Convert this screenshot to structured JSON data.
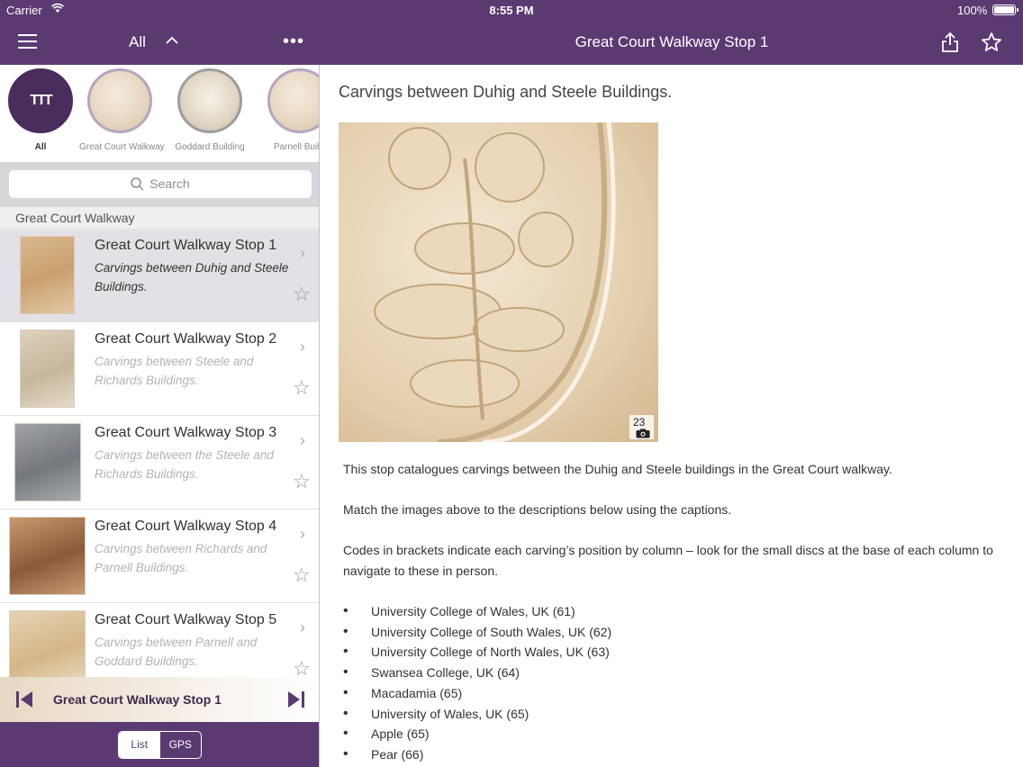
{
  "status_bar": {
    "carrier": "Carrier",
    "time": "8:55 PM",
    "battery": "100%"
  },
  "header": {
    "filter_label": "All",
    "more_label": "•••",
    "detail_title": "Great Court Walkway Stop 1"
  },
  "categories": [
    {
      "label": "All",
      "logo_text": "TTT",
      "active": true
    },
    {
      "label": "Great Court Walkway",
      "active": false
    },
    {
      "label": "Goddard Building",
      "active": false
    },
    {
      "label": "Parnell Buildi",
      "active": false
    }
  ],
  "search": {
    "placeholder": "Search"
  },
  "section_header": "Great Court Walkway",
  "stops": [
    {
      "title": "Great Court Walkway Stop 1",
      "subtitle": "Carvings between Duhig and Steele Buildings.",
      "selected": true
    },
    {
      "title": "Great Court Walkway Stop 2",
      "subtitle": "Carvings between Steele and Richards Buildings.",
      "selected": false
    },
    {
      "title": "Great Court Walkway Stop 3",
      "subtitle": "Carvings between the Steele and Richards Buildings.",
      "selected": false
    },
    {
      "title": "Great Court Walkway Stop 4",
      "subtitle": "Carvings between Richards and Parnell Buildings.",
      "selected": false
    },
    {
      "title": "Great Court Walkway Stop 5",
      "subtitle": "Carvings between Parnell and Goddard Buildings.",
      "selected": false
    }
  ],
  "now_playing": {
    "title": "Great Court Walkway Stop 1"
  },
  "view_toggle": {
    "list_label": "List",
    "gps_label": "GPS",
    "selected": "List"
  },
  "detail": {
    "heading": "Carvings between Duhig and Steele Buildings.",
    "photo_count": "23",
    "paragraphs": [
      "This stop catalogues carvings between the Duhig and Steele buildings in the Great Court walkway.",
      "Match the images above to the descriptions below using the captions.",
      "Codes in brackets indicate each carving’s position by column – look for the small discs at the base of each column to navigate to these in person."
    ],
    "bullets": [
      "University College of Wales, UK (61)",
      "University College of South Wales, UK (62)",
      "University College of North Wales, UK (63)",
      "Swansea College, UK (64)",
      "Macadamia (65)",
      "University of Wales, UK (65)",
      "Apple (65)",
      "Pear (66)"
    ]
  },
  "colors": {
    "brand_purple": "#5b3a72",
    "selected_row": "#e3e1e5",
    "stone": "#e9dac3"
  },
  "icons": [
    "wifi-icon",
    "battery-icon",
    "menu-icon",
    "chevron-up-icon",
    "share-icon",
    "star-icon",
    "search-icon",
    "chevron-right-icon",
    "skip-previous-icon",
    "skip-next-icon",
    "camera-icon"
  ]
}
